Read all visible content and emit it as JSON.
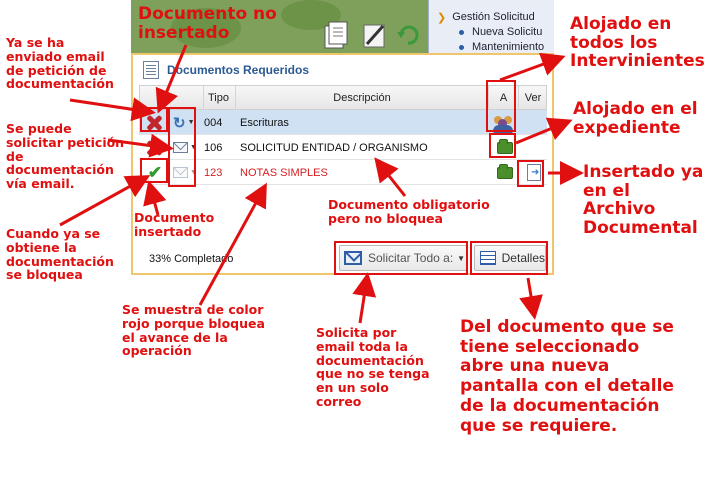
{
  "background": {
    "tree_items": [
      "Gestión Solicitud",
      "Nueva Solicitu",
      "Mantenimiento"
    ]
  },
  "panel": {
    "title": "Documentos Requeridos",
    "columns": {
      "tipo": "Tipo",
      "descripcion": "Descripción",
      "a": "A",
      "ver": "Ver"
    },
    "rows": [
      {
        "status": "x-icon",
        "action": "refresh-icon",
        "tipo": "004",
        "descripcion": "Escrituras",
        "selected": true,
        "blocking": false,
        "a_icon": "people-icon",
        "ver_icon": ""
      },
      {
        "status": "x-icon",
        "action": "mail-icon",
        "tipo": "106",
        "descripcion": "SOLICITUD ENTIDAD / ORGANISMO",
        "selected": false,
        "blocking": false,
        "a_icon": "folder-icon",
        "ver_icon": ""
      },
      {
        "status": "check-icon",
        "action": "mail-icon",
        "tipo": "123",
        "descripcion": "NOTAS SIMPLES",
        "selected": false,
        "blocking": true,
        "a_icon": "folder-icon",
        "ver_icon": "insert-icon"
      }
    ],
    "progress_text": "33% Completado",
    "solicitar_label": "Solicitar Todo a:",
    "detalles_label": "Detalles"
  },
  "annotations": {
    "doc_no_insertado": "Documento no\ninsertado",
    "ya_enviado": "Ya se ha\nenviado email\nde petición de\ndocumentación",
    "puede_solicitar": "Se puede\nsolicitar petición\nde\ndocumentación\nvía email.",
    "cuando_obtiene": "Cuando ya se\nobtiene la\ndocumentación\nse bloquea",
    "doc_insertado": "Documento\ninsertado",
    "color_rojo": "Se muestra de color\nrojo porque bloquea\nel avance de la\noperación",
    "solicita_email": "Solicita por\nemail toda la\ndocumentación\nque no se tenga\nen un solo\ncorreo",
    "obligatorio": "Documento obligatorio\npero no bloquea",
    "alojado_todos": "Alojado en\ntodos los\nIntervinientes",
    "alojado_expediente": "Alojado en el\nexpediente",
    "insertado_archivo": "Insertado ya\nen el\nArchivo\nDocumental",
    "del_documento": "Del documento que se\ntiene seleccionado\nabre una nueva\npantalla con el detalle\nde la documentación\nque se requiere."
  },
  "colors": {
    "annotation": "#e01010",
    "panel_border": "#f0c66c",
    "title": "#2b5a93",
    "selected_row": "#cfe1f3"
  }
}
